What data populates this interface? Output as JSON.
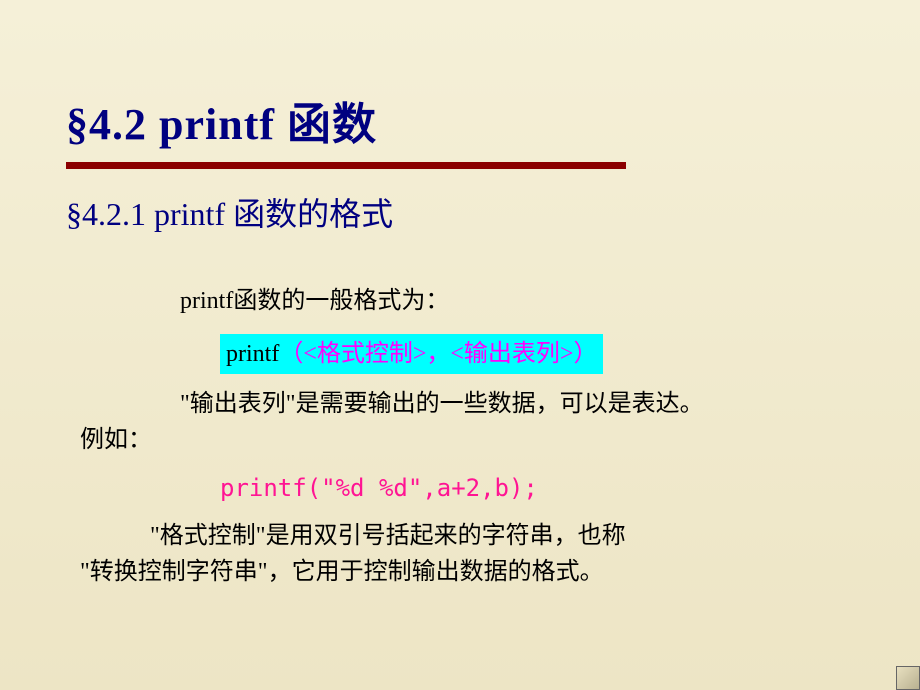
{
  "title": "§4.2   printf 函数",
  "subtitle": "§4.2.1   printf  函数的格式",
  "intro": "printf函数的一般格式为：",
  "highlight": {
    "printf_word": "printf",
    "paren_content": "（<格式控制>，<输出表列>）"
  },
  "output_desc_line1": "\"输出表列\"是需要输出的一些数据，可以是表达。",
  "output_desc_line2": "例如：",
  "example": "printf(\"%d %d\",a+2,b);",
  "format_desc_line1": "\"格式控制\"是用双引号括起来的字符串，也称",
  "format_desc_line2": "\"转换控制字符串\"，它用于控制输出数据的格式。"
}
